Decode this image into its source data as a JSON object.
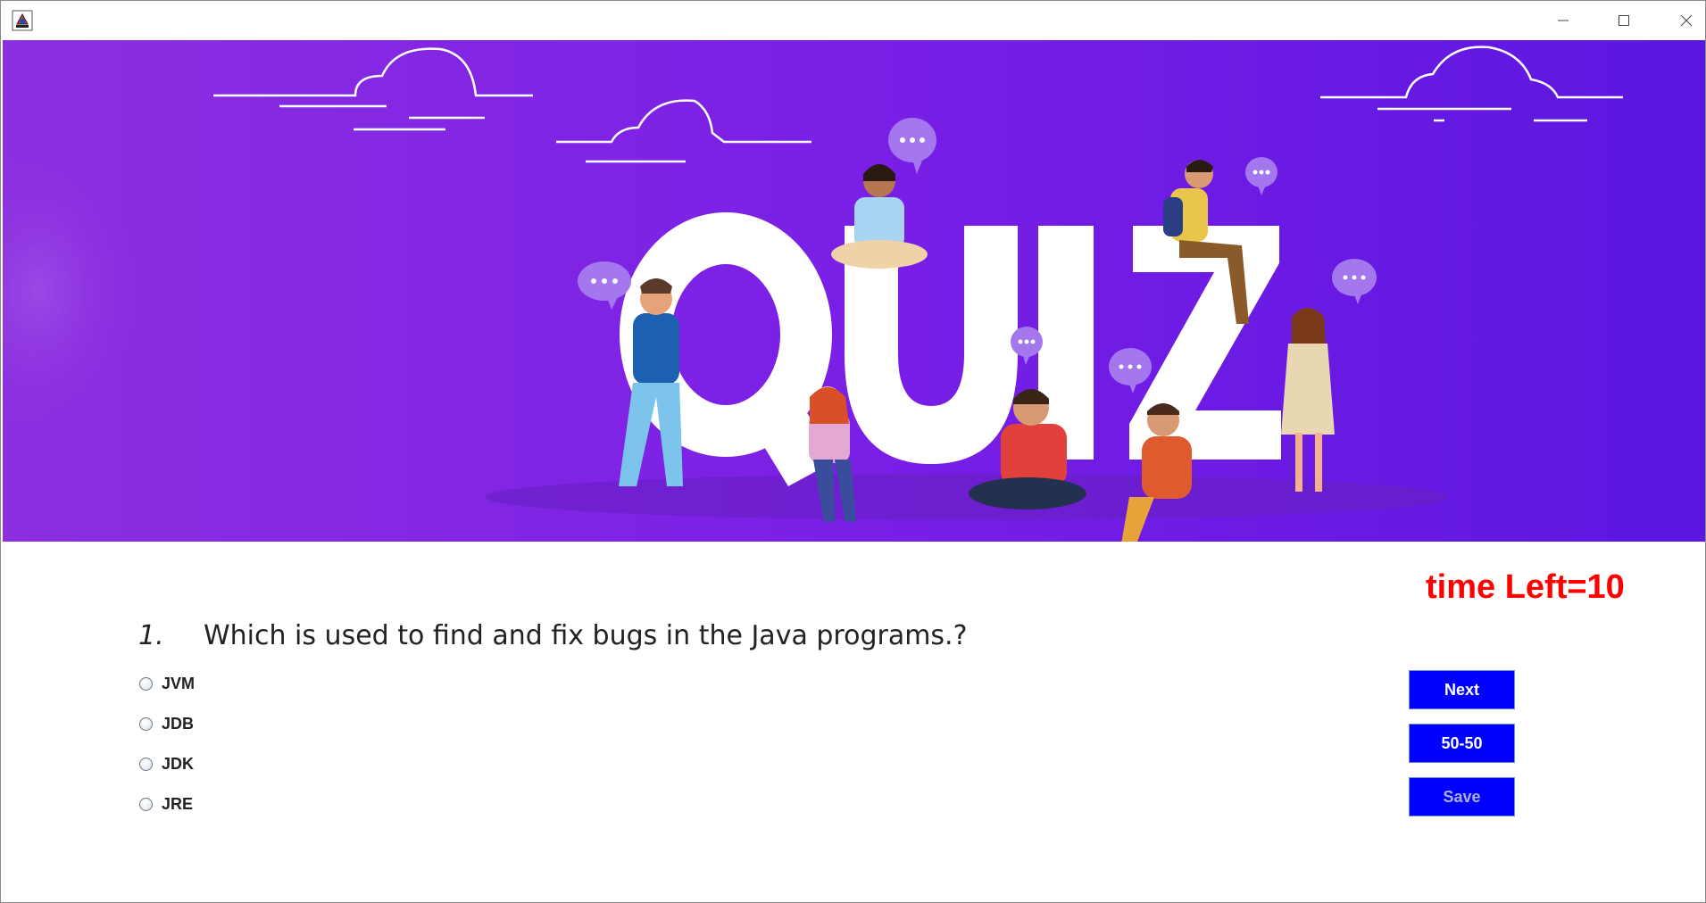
{
  "window": {
    "icon": "java-app-icon",
    "controls": [
      "minimize-icon",
      "maximize-icon",
      "close-icon"
    ]
  },
  "banner": {
    "title": "QUIZ",
    "background_start": "#8c2fe0",
    "background_end": "#5b16e0"
  },
  "timer": {
    "text": "time Left=10",
    "color": "#ff0000"
  },
  "question": {
    "number": "1.",
    "text": "Which is used to find and fix bugs in the Java programs.?"
  },
  "options": [
    {
      "label": "JVM",
      "selected": false
    },
    {
      "label": "JDB",
      "selected": false
    },
    {
      "label": "JDK",
      "selected": false
    },
    {
      "label": "JRE",
      "selected": false
    }
  ],
  "buttons": {
    "next": "Next",
    "fifty_fifty": "50-50",
    "save": "Save",
    "color": "#0000ff",
    "save_enabled": false
  }
}
